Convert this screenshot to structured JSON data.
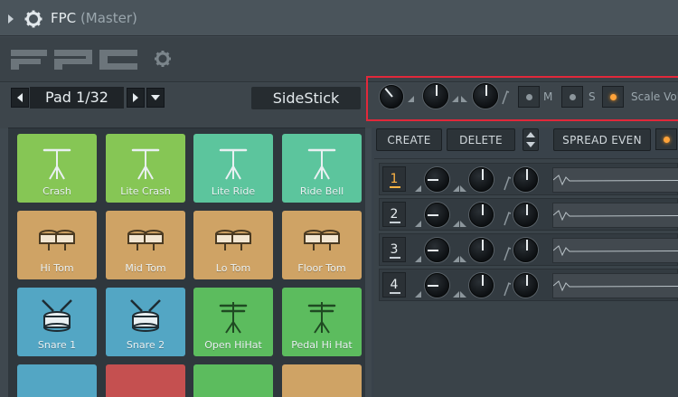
{
  "window": {
    "title": "FPC",
    "subtitle": "(Master)"
  },
  "pad_selector": {
    "label": "Pad 1/32",
    "sound_name": "SideStick"
  },
  "controls": {
    "mute_label": "M",
    "solo_label": "S",
    "scale_label": "Scale Vol"
  },
  "layer_buttons": {
    "create": "CREATE",
    "delete": "DELETE",
    "spread": "SPREAD EVEN"
  },
  "layers": [
    {
      "number": "1",
      "selected": true
    },
    {
      "number": "2",
      "selected": false
    },
    {
      "number": "3",
      "selected": false
    },
    {
      "number": "4",
      "selected": false
    }
  ],
  "pads": [
    {
      "label": "Crash",
      "color": "#86c655",
      "icon": "cymbal-icon"
    },
    {
      "label": "Lite Crash",
      "color": "#86c655",
      "icon": "cymbal-icon"
    },
    {
      "label": "Lite Ride",
      "color": "#5cc59d",
      "icon": "cymbal-icon"
    },
    {
      "label": "Ride Bell",
      "color": "#5cc59d",
      "icon": "cymbal-icon"
    },
    {
      "label": "Hi Tom",
      "color": "#cfa365",
      "icon": "tom-drums-icon"
    },
    {
      "label": "Mid Tom",
      "color": "#cfa365",
      "icon": "tom-drums-icon"
    },
    {
      "label": "Lo Tom",
      "color": "#cfa365",
      "icon": "tom-drums-icon"
    },
    {
      "label": "Floor Tom",
      "color": "#cfa365",
      "icon": "tom-drums-icon"
    },
    {
      "label": "Snare 1",
      "color": "#53a6c4",
      "icon": "snare-drum-icon"
    },
    {
      "label": "Snare 2",
      "color": "#53a6c4",
      "icon": "snare-drum-icon"
    },
    {
      "label": "Open HiHat",
      "color": "#5cbc5e",
      "icon": "hihat-icon"
    },
    {
      "label": "Pedal Hi Hat",
      "color": "#5cbc5e",
      "icon": "hihat-icon"
    }
  ],
  "colors": {
    "accent": "#ffa33a",
    "highlight_box": "#e2283a"
  }
}
